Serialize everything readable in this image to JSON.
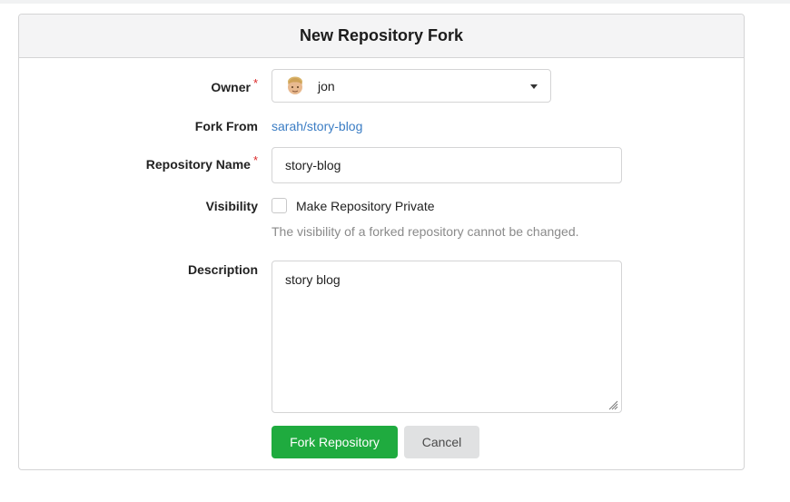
{
  "form": {
    "title": "New Repository Fork",
    "owner": {
      "label": "Owner",
      "required_mark": "*",
      "value": "jon",
      "avatar_icon": "user-avatar-emoji"
    },
    "fork_from": {
      "label": "Fork From",
      "link_text": "sarah/story-blog"
    },
    "repo_name": {
      "label": "Repository Name",
      "required_mark": "*",
      "value": "story-blog"
    },
    "visibility": {
      "label": "Visibility",
      "checkbox_label": "Make Repository Private",
      "checked": false,
      "help": "The visibility of a forked repository cannot be changed."
    },
    "description": {
      "label": "Description",
      "value": "story blog"
    },
    "buttons": {
      "submit": "Fork Repository",
      "cancel": "Cancel"
    }
  },
  "colors": {
    "primary_button": "#21ba45",
    "link": "#3b7dc4",
    "required": "#db2828",
    "help_text": "#8a8a8a"
  }
}
